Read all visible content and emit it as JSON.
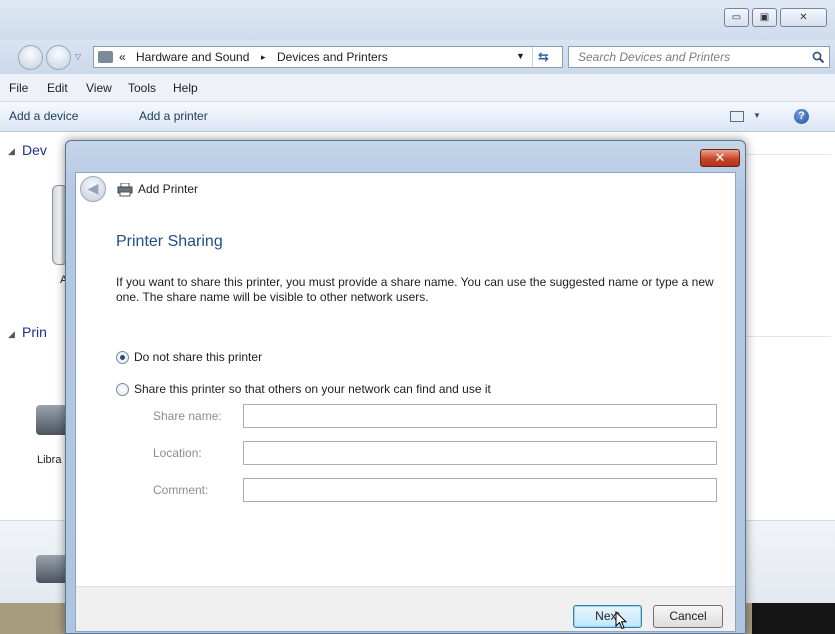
{
  "explorer": {
    "window_buttons": [
      "▭",
      "▣",
      "✕"
    ],
    "breadcrumb": {
      "prefix": "«",
      "items": [
        "Hardware and Sound",
        "Devices and Printers"
      ],
      "separator": "▸"
    },
    "search": {
      "placeholder": "Search Devices and Printers"
    },
    "menu": [
      "File",
      "Edit",
      "View",
      "Tools",
      "Help"
    ],
    "commands": [
      "Add a device",
      "Add a printer"
    ],
    "groups": [
      {
        "label": "Dev"
      },
      {
        "label": "Prin"
      }
    ],
    "partial_labels": [
      "A",
      "Libra"
    ]
  },
  "dialog": {
    "close_label": "✕",
    "title": "Add Printer",
    "section_title": "Printer Sharing",
    "description": "If you want to share this printer, you must provide a share name. You can use the suggested name or type a new one. The share name will be visible to other network users.",
    "options": [
      {
        "label": "Do not share this printer",
        "selected": true
      },
      {
        "label": "Share this printer so that others on your network can find and use it",
        "selected": false
      }
    ],
    "fields": [
      {
        "label": "Share name:",
        "value": ""
      },
      {
        "label": "Location:",
        "value": ""
      },
      {
        "label": "Comment:",
        "value": ""
      }
    ],
    "buttons": {
      "next": "Next",
      "cancel": "Cancel"
    }
  },
  "colors": {
    "accent": "#1e4e8c",
    "close_red": "#c8452b"
  }
}
